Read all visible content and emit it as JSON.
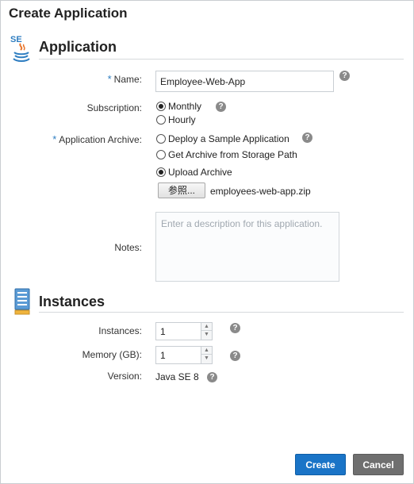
{
  "dialog": {
    "title": "Create Application"
  },
  "application_section": {
    "title": "Application",
    "icon": "java-se-icon",
    "name": {
      "required_mark": "*",
      "label": "Name:",
      "value": "Employee-Web-App"
    },
    "subscription": {
      "label": "Subscription:",
      "options": [
        {
          "label": "Monthly",
          "selected": true
        },
        {
          "label": "Hourly",
          "selected": false
        }
      ]
    },
    "archive": {
      "required_mark": "*",
      "label": "Application Archive:",
      "options": [
        {
          "label": "Deploy a Sample Application",
          "selected": false
        },
        {
          "label": "Get Archive from Storage Path",
          "selected": false
        },
        {
          "label": "Upload Archive",
          "selected": true
        }
      ],
      "browse_label": "参照...",
      "file_name": "employees-web-app.zip"
    },
    "notes": {
      "label": "Notes:",
      "placeholder": "Enter a description for this application."
    }
  },
  "instances_section": {
    "title": "Instances",
    "icon": "server-instances-icon",
    "instances": {
      "label": "Instances:",
      "value": "1"
    },
    "memory": {
      "label": "Memory (GB):",
      "value": "1"
    },
    "version": {
      "label": "Version:",
      "value": "Java SE 8"
    }
  },
  "help_glyph": "?",
  "spinner": {
    "up": "▲",
    "down": "▼"
  },
  "buttons": {
    "create": "Create",
    "cancel": "Cancel"
  },
  "colors": {
    "primary_button": "#1a74c7",
    "secondary_button": "#6f6f6f",
    "required_mark": "#2f7ec1"
  }
}
